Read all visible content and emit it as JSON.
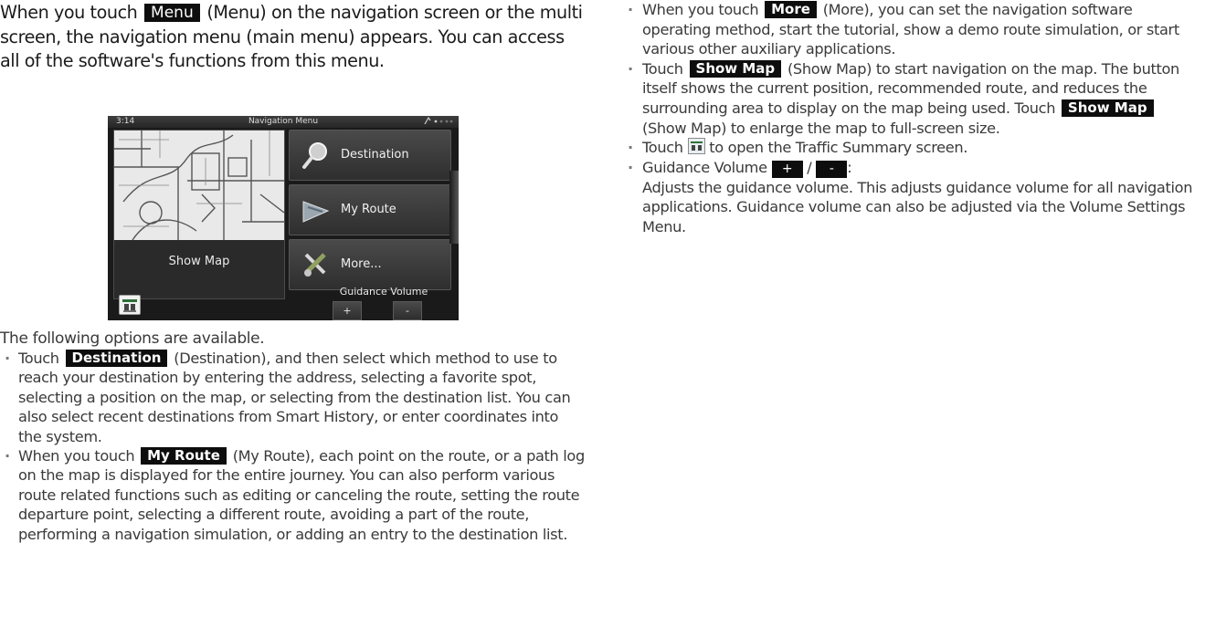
{
  "intro": {
    "part1": "When you touch ",
    "menu_button": "Menu",
    "part2": " (Menu) on the navigation screen or the multi screen, the navigation menu (main menu) appears. You can access all of the software's functions from this menu."
  },
  "screen": {
    "time": "3:14",
    "title": "Navigation Menu",
    "show_map": "Show Map",
    "destination": "Destination",
    "my_route": "My Route",
    "more": "More...",
    "guidance_volume": "Guidance Volume",
    "plus": "+",
    "minus": "-"
  },
  "options_intro": "The following options are available.",
  "left_bullets": {
    "destination": {
      "pre": "Touch ",
      "tag": "Destination",
      "post": " (Destination), and then select which method to use to reach your destination by entering the address, selecting a favorite spot, selecting a position on the map, or selecting from the destination list. You can also select recent destinations from Smart History, or enter coordinates into the system."
    },
    "my_route": {
      "pre": "When you touch ",
      "tag": "My Route",
      "post": " (My Route), each point on the route, or a path log on the map is displayed for the entire journey. You can also perform various route related functions such as editing or canceling the route, setting the route departure point, selecting a different route, avoiding a part of the route, performing a navigation simulation, or adding an entry to the destination list."
    }
  },
  "right_bullets": {
    "more": {
      "pre": "When you touch ",
      "tag": "More",
      "post": " (More), you can set the navigation software operating method, start the tutorial, show a demo route simulation, or start various other auxiliary applications."
    },
    "show_map": {
      "pre": "Touch ",
      "tag": "Show Map",
      "mid": " (Show Map) to start navigation on the map. The button itself shows the current position, recommended route, and reduces the surrounding area to display on the map being used. Touch ",
      "tag2": "Show Map",
      "post": " (Show Map) to enlarge the map to full-screen size."
    },
    "traffic": {
      "pre": "Touch ",
      "post": " to open the Traffic Summary screen."
    },
    "guidance": {
      "pre": "Guidance Volume ",
      "plus": "+",
      "sep": " / ",
      "minus": "-",
      "colon": ":",
      "desc": "Adjusts the guidance volume. This adjusts guidance volume for all navigation applications.  Guidance volume can also be adjusted via the Volume Settings Menu."
    }
  }
}
